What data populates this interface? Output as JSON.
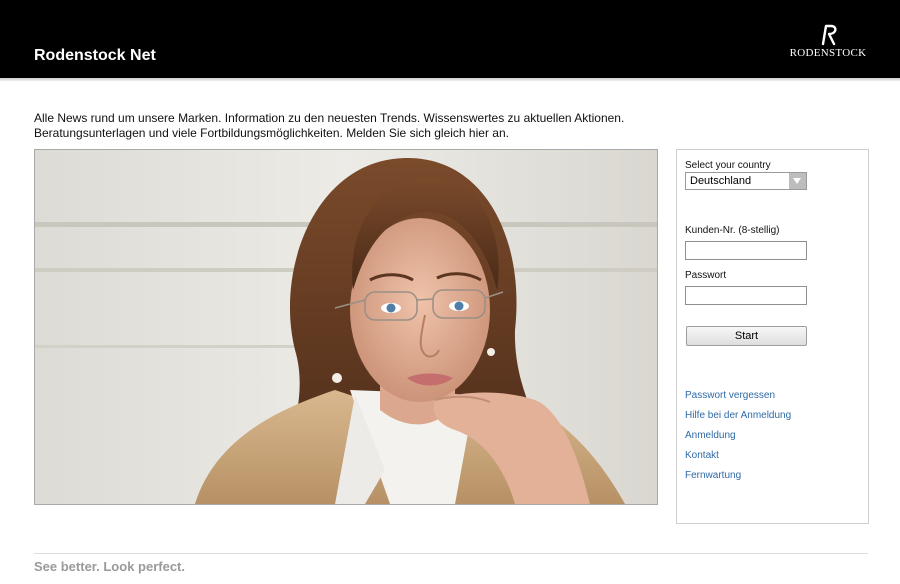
{
  "header": {
    "title": "Rodenstock Net",
    "logo_text": "RODENSTOCK"
  },
  "intro": {
    "line1": "Alle News rund um unsere Marken. Information zu den neuesten Trends. Wissenswertes zu aktuellen Aktionen.",
    "line2": "Beratungsunterlagen und viele Fortbildungsmöglichkeiten. Melden Sie sich gleich hier an."
  },
  "login": {
    "country_label": "Select your country",
    "country_value": "Deutschland",
    "customer_label": "Kunden-Nr. (8-stellig)",
    "customer_value": "",
    "password_label": "Passwort",
    "password_value": "",
    "submit_label": "Start"
  },
  "links": [
    "Passwort vergessen",
    "Hilfe bei der Anmeldung",
    "Anmeldung",
    "Kontakt",
    "Fernwartung"
  ],
  "footer": {
    "tagline": "See better. Look perfect."
  },
  "icons": {
    "dropdown": "chevron-down-icon",
    "logo": "rodenstock-r-logo"
  },
  "colors": {
    "header_bg": "#000000",
    "link": "#2f6aa6",
    "tagline": "#9a9a9a"
  }
}
